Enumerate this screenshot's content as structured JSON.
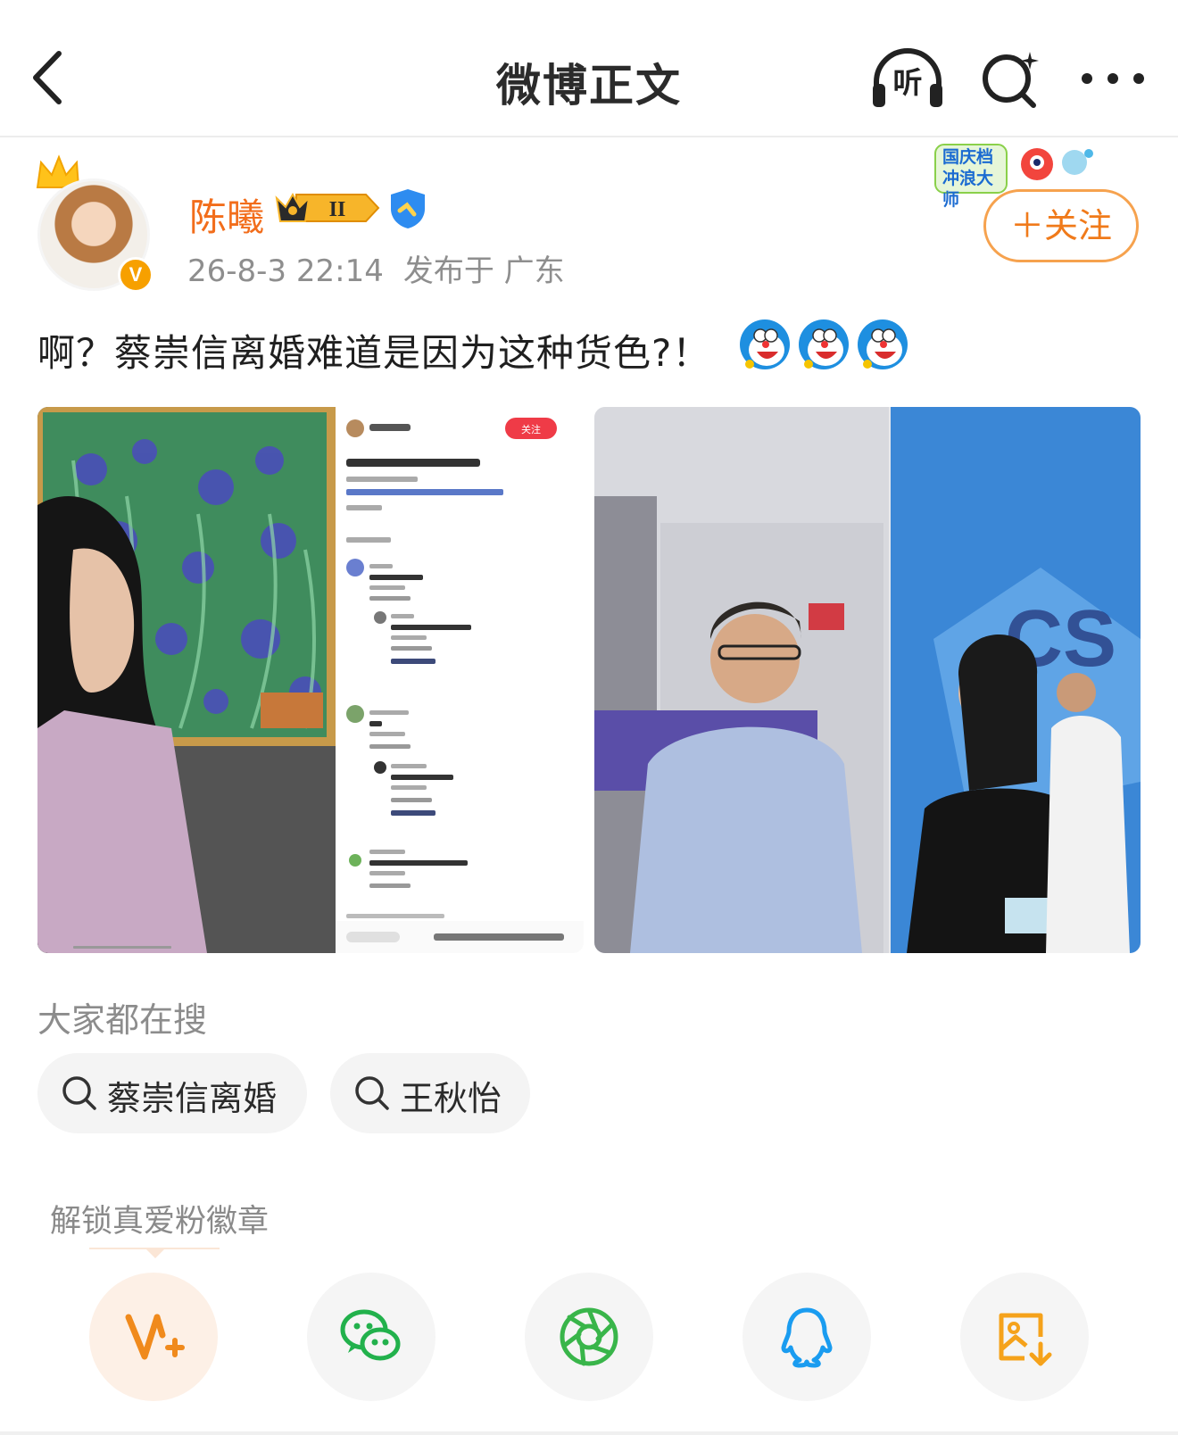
{
  "header": {
    "title": "微博正文",
    "listen_label": "听"
  },
  "author": {
    "name": "陈曦",
    "level_badge": "II",
    "verified_badge": "V",
    "time": "26-8-3 22:14",
    "location": "发布于 广东",
    "follow_label": "＋关注"
  },
  "promo": {
    "line1": "国庆档",
    "line2": "冲浪大师"
  },
  "post": {
    "text": "啊？蔡崇信离婚难道是因为这种货色?！"
  },
  "search_section": {
    "label": "大家都在搜",
    "chips": [
      {
        "label": "蔡崇信离婚"
      },
      {
        "label": "王秋怡"
      }
    ]
  },
  "unlock": {
    "label": "解锁真爱粉徽章"
  },
  "share": {
    "items": [
      {
        "icon": "fan-badge-icon",
        "color": "#f08a1c"
      },
      {
        "icon": "wechat-icon",
        "color": "#22b14c"
      },
      {
        "icon": "moments-icon",
        "color": "#39b54a"
      },
      {
        "icon": "qq-icon",
        "color": "#1a9cf0"
      },
      {
        "icon": "save-image-icon",
        "color": "#f5a21b"
      }
    ]
  },
  "screenshot_in_image": {
    "follow_label": "关注"
  },
  "colors": {
    "accent": "#f07a1a",
    "username": "#f26d1b",
    "meta": "#8e8e8e"
  }
}
